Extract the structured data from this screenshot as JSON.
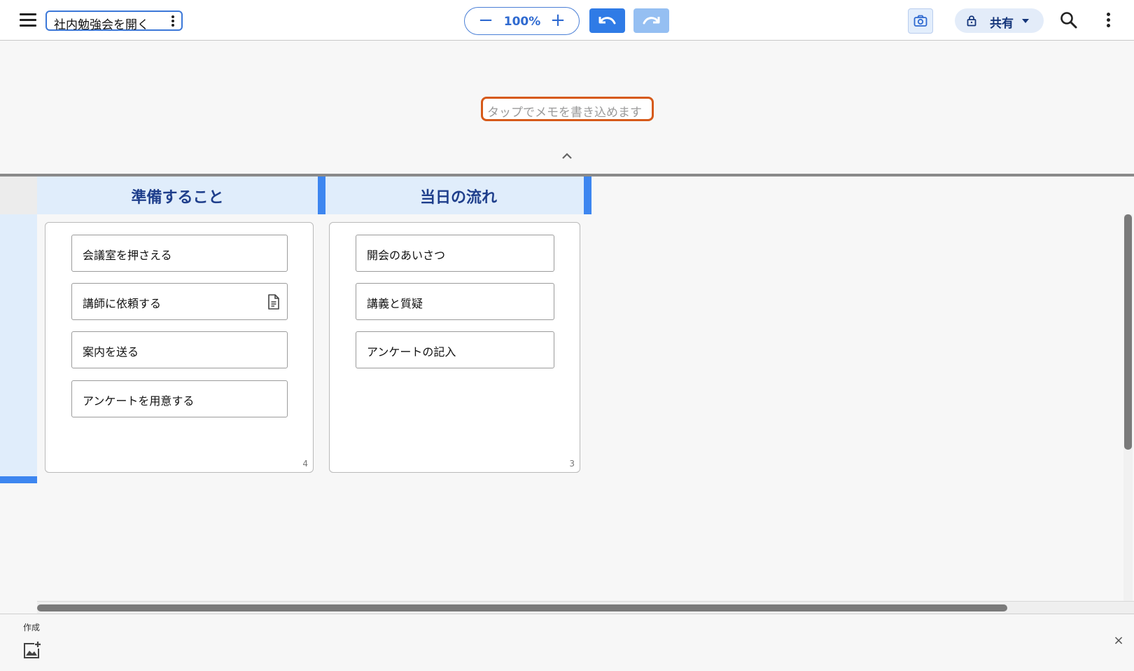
{
  "header": {
    "title": "社内勉強会を開く",
    "zoom_level": "100%",
    "zoom_minus": "−",
    "zoom_plus": "+",
    "share_label": "共有"
  },
  "memo": {
    "placeholder": "タップでメモを書き込めます"
  },
  "board": {
    "columns": [
      {
        "title": "準備すること",
        "count": "4",
        "cards": [
          {
            "label": "会議室を押さえる",
            "has_note": false
          },
          {
            "label": "講師に依頼する",
            "has_note": true
          },
          {
            "label": "案内を送る",
            "has_note": false
          },
          {
            "label": "アンケートを用意する",
            "has_note": false
          }
        ]
      },
      {
        "title": "当日の流れ",
        "count": "3",
        "cards": [
          {
            "label": "開会のあいさつ"
          },
          {
            "label": "講義と質疑"
          },
          {
            "label": "アンケートの記入"
          }
        ]
      }
    ]
  },
  "bottom": {
    "label": "作成",
    "close": "×"
  },
  "colors": {
    "accent": "#2f7be6",
    "accent_light": "#95bff2",
    "column_header_bg": "#e0edfb",
    "column_header_text": "#1f3f8c",
    "memo_border": "#d65a1a"
  },
  "icons": {
    "menu": "hamburger-menu-icon",
    "title_more": "more-vertical-icon",
    "undo": "undo-icon",
    "redo": "redo-icon",
    "camera": "camera-icon",
    "lock": "lock-icon",
    "search": "search-icon",
    "more": "more-vertical-icon",
    "collapse": "chevron-up-icon",
    "note": "document-icon",
    "add_image": "add-image-icon",
    "close": "close-icon"
  }
}
